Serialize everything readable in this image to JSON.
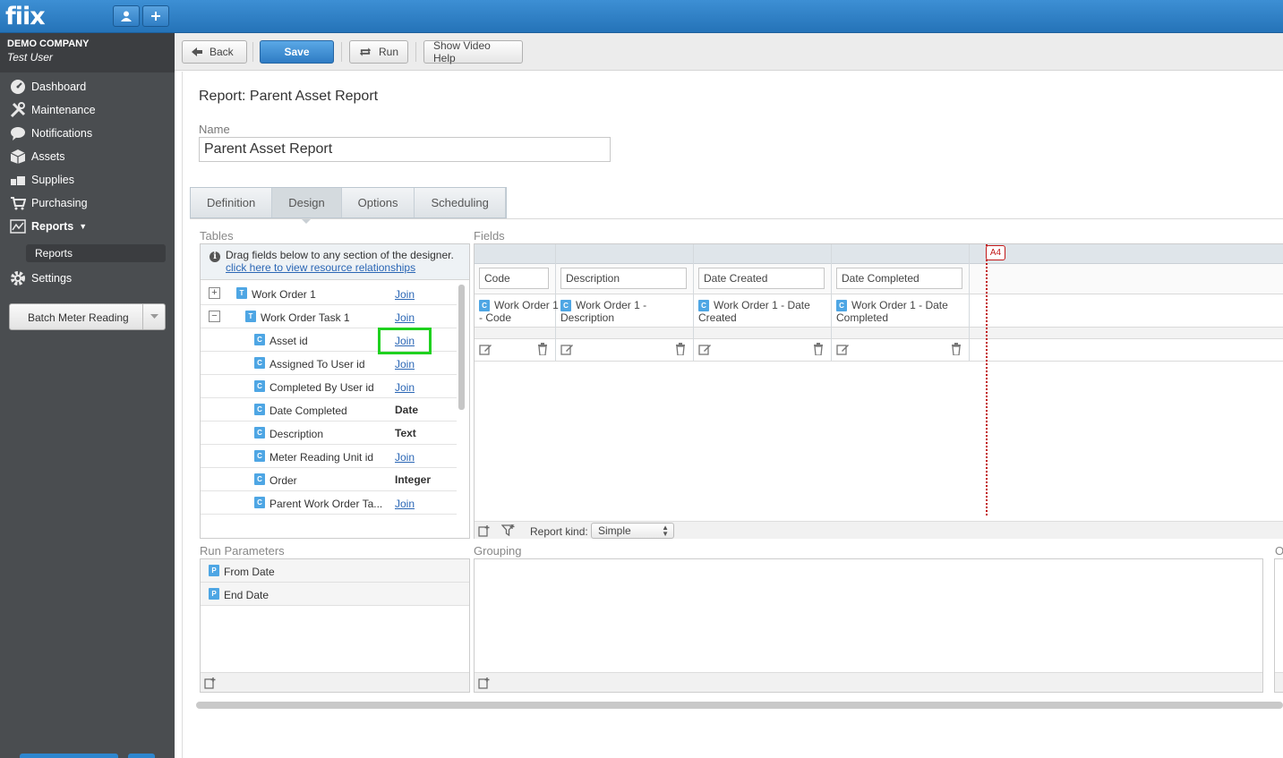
{
  "app": {
    "logo": "fiix",
    "company": "DEMO COMPANY",
    "user": "Test User"
  },
  "sidebar": {
    "items": [
      {
        "label": "Dashboard",
        "icon": "dashboard-icon"
      },
      {
        "label": "Maintenance",
        "icon": "tools-icon"
      },
      {
        "label": "Notifications",
        "icon": "chat-bubble-icon"
      },
      {
        "label": "Assets",
        "icon": "box-icon"
      },
      {
        "label": "Supplies",
        "icon": "supplies-icon"
      },
      {
        "label": "Purchasing",
        "icon": "cart-icon"
      },
      {
        "label": "Reports",
        "icon": "chart-icon"
      },
      {
        "label": "Settings",
        "icon": "gear-icon"
      }
    ],
    "subitem": "Reports",
    "batch_button": "Batch Meter Reading"
  },
  "toolbar": {
    "back": "Back",
    "save": "Save",
    "run": "Run",
    "video_help": "Show Video Help"
  },
  "report": {
    "title": "Report: Parent Asset Report",
    "name_label": "Name",
    "name_value": "Parent Asset Report"
  },
  "tabs": [
    "Definition",
    "Design",
    "Options",
    "Scheduling"
  ],
  "tables": {
    "label": "Tables",
    "hint": "Drag fields below to any section of the designer.",
    "hint_link": "click here to view resource relationships",
    "rows": [
      {
        "name": "Work Order 1",
        "badge": "T",
        "kind": "join",
        "value": "Join",
        "toggle": "+"
      },
      {
        "name": "Work Order Task 1",
        "badge": "T",
        "kind": "join",
        "value": "Join",
        "toggle": "−"
      },
      {
        "name": "Asset id",
        "badge": "C",
        "kind": "join",
        "value": "Join"
      },
      {
        "name": "Assigned To User id",
        "badge": "C",
        "kind": "join",
        "value": "Join"
      },
      {
        "name": "Completed By User id",
        "badge": "C",
        "kind": "join",
        "value": "Join"
      },
      {
        "name": "Date Completed",
        "badge": "C",
        "kind": "type",
        "value": "Date"
      },
      {
        "name": "Description",
        "badge": "C",
        "kind": "type",
        "value": "Text"
      },
      {
        "name": "Meter Reading Unit id",
        "badge": "C",
        "kind": "join",
        "value": "Join"
      },
      {
        "name": "Order",
        "badge": "C",
        "kind": "type",
        "value": "Integer"
      },
      {
        "name": "Parent Work Order Ta...",
        "badge": "C",
        "kind": "join",
        "value": "Join"
      }
    ]
  },
  "fields": {
    "label": "Fields",
    "page_marker": "A4",
    "columns": [
      {
        "header": "Code",
        "line1": "Work Order 1",
        "line2": "- Code"
      },
      {
        "header": "Description",
        "line1": "Work Order 1 -",
        "line2": "Description"
      },
      {
        "header": "Date Created",
        "line1": "Work Order 1 - Date",
        "line2": "Created"
      },
      {
        "header": "Date Completed",
        "line1": "Work Order 1 - Date",
        "line2": "Completed"
      }
    ],
    "report_kind_label": "Report kind:",
    "report_kind_value": "Simple"
  },
  "run_parameters": {
    "label": "Run Parameters",
    "items": [
      "From Date",
      "End Date"
    ]
  },
  "grouping": {
    "label": "Grouping"
  },
  "third_section": {
    "label": "O"
  }
}
